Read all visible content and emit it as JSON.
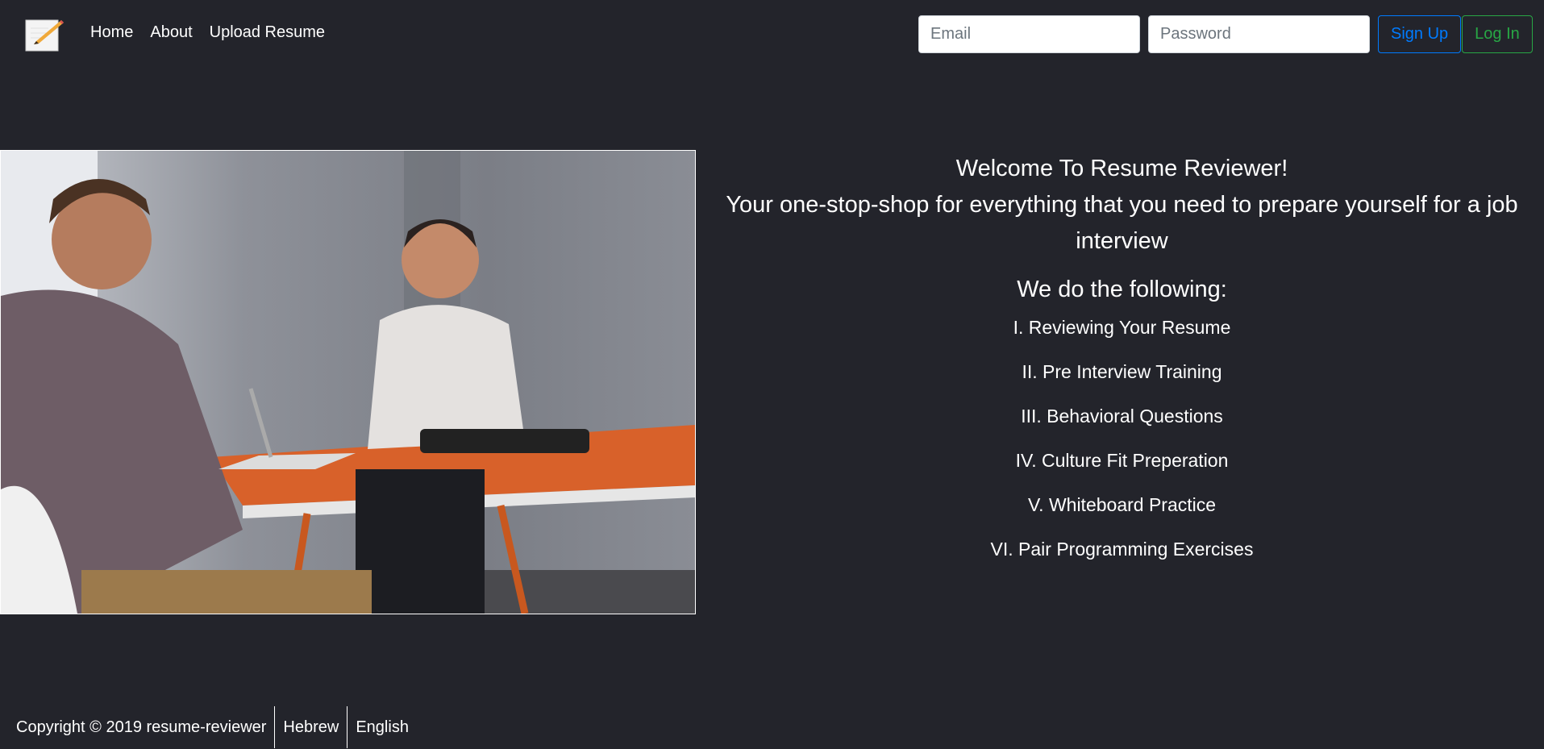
{
  "nav": {
    "logo_icon": "notepad-pencil-icon",
    "links": [
      "Home",
      "About",
      "Upload Resume"
    ]
  },
  "auth": {
    "email_placeholder": "Email",
    "email_value": "",
    "password_placeholder": "Password",
    "password_value": "",
    "signup_label": "Sign Up",
    "login_label": "Log In"
  },
  "hero": {
    "welcome": "Welcome To Resume Reviewer!",
    "tagline": "Your one-stop-shop for everything that you need to prepare yourself for a job interview",
    "following_heading": "We do the following:",
    "services": [
      "I. Reviewing Your Resume",
      "II. Pre Interview Training",
      "III. Behavioral Questions",
      "IV. Culture Fit Preperation",
      "V. Whiteboard Practice",
      "VI. Pair Programming Exercises"
    ]
  },
  "footer": {
    "copyright": "Copyright © 2019  resume-reviewer",
    "languages": [
      "Hebrew",
      "English"
    ]
  },
  "colors": {
    "background": "#23242b",
    "signup": "#007bff",
    "login": "#28a745"
  }
}
